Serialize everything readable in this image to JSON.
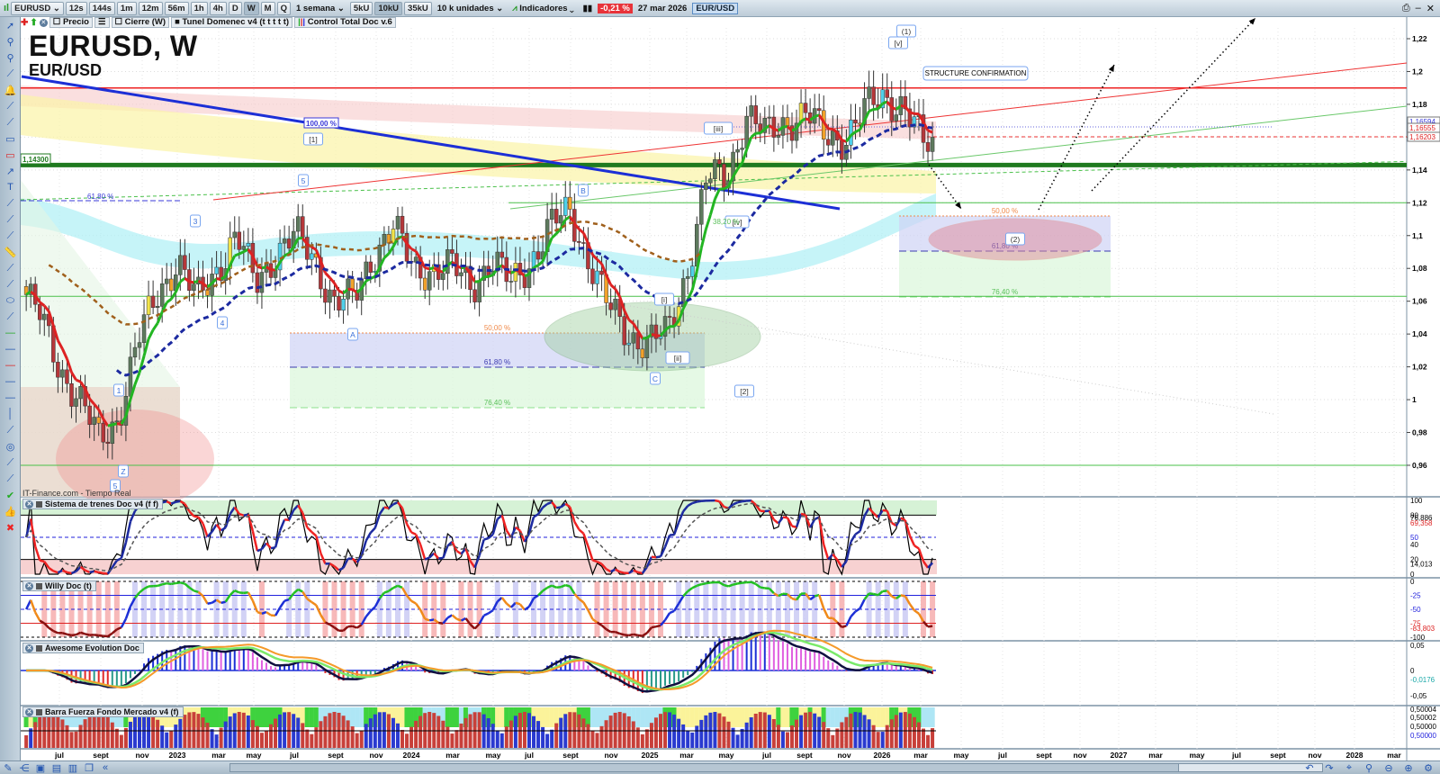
{
  "toolbar": {
    "symbol": "EURUSD",
    "timeframes": [
      "12s",
      "144s",
      "1m",
      "12m",
      "56m",
      "1h",
      "4h",
      "D",
      "W",
      "M",
      "Q"
    ],
    "active_timeframe": "W",
    "period": "1 semana",
    "volume_buttons": [
      "5kU",
      "10kU",
      "35kU"
    ],
    "active_volume": "10kU",
    "units": "10 k unidades",
    "indicators_label": "Indicadores",
    "change_pct": "-0,21 %",
    "date": "27 mar 2026",
    "pair": "EUR/USD"
  },
  "subbar": {
    "items": [
      "Precio",
      "Cierre (W)",
      "Tunel Domenec v4 (t t t t t)",
      "Control Total Doc v.6"
    ]
  },
  "main": {
    "title": "EURUSD, W",
    "subtitle": "EUR/USD",
    "source": "IT-Finance.com - Tiempo Real",
    "level_label": "1,14300",
    "annotation_box": "STRUCTURE CONFIRMATION",
    "fib_left": {
      "p50": "50,00 %",
      "p618": "61,80 %",
      "p764": "76,40 %"
    },
    "fib_right": {
      "p50": "50,00 %",
      "p618": "61,80 %",
      "p764": "76,40 %"
    },
    "fib_100": "100,00 %",
    "fib_6180_left": "61,80 %",
    "fib_382": "38,20 %",
    "waves": [
      "5",
      "Z",
      "1",
      "3",
      "4",
      "5",
      "A",
      "B",
      "C",
      "[i]",
      "[ii]",
      "[iii]",
      "[iv]",
      "[v]",
      "(1)",
      "[1]",
      "[2]",
      "(2)"
    ],
    "price_tags": {
      "blue": "1,16594",
      "red1": "1,16555",
      "red2": "1,16203"
    }
  },
  "price_axis": {
    "ticks": [
      "1,22",
      "1,2",
      "1,18",
      "1,16",
      "1,14",
      "1,12",
      "1,1",
      "1,08",
      "1,06",
      "1,04",
      "1,02",
      "1",
      "0,98",
      "0,96"
    ]
  },
  "panels": [
    {
      "name": "Sistema de trenes Doc v4 (f f)",
      "axis": [
        "100",
        "80",
        "76,886",
        "69,358",
        "50",
        "40",
        "20",
        "14,013",
        "0"
      ]
    },
    {
      "name": "Willy Doc (t)",
      "axis": [
        "0",
        "-25",
        "-50",
        "-75",
        "-83,803",
        "-100"
      ]
    },
    {
      "name": "Awesome Evolution Doc",
      "axis": [
        "0,05",
        "0",
        "-0,0176",
        "-0,05"
      ]
    },
    {
      "name": "Barra Fuerza Fondo Mercado v4 (f)",
      "axis": [
        "0,50004",
        "0,50002",
        "0,50000",
        "0,50000"
      ]
    }
  ],
  "time_axis": {
    "labels": [
      "jul",
      "sept",
      "nov",
      "2023",
      "mar",
      "may",
      "jul",
      "sept",
      "nov",
      "2024",
      "mar",
      "may",
      "jul",
      "sept",
      "nov",
      "2025",
      "mar",
      "may",
      "jul",
      "sept",
      "nov",
      "2026",
      "mar",
      "may",
      "jul",
      "sept",
      "nov",
      "2027",
      "mar",
      "may",
      "jul",
      "sept",
      "nov",
      "2028",
      "mar"
    ]
  },
  "colors": {
    "bull": "#5e7a5e",
    "bear": "#b5373a",
    "accent_red": "#e8333a",
    "green_level": "#1f7a1f",
    "blue_trend": "#1c2fd6"
  },
  "chart_data": {
    "type": "candlestick",
    "interval": "weekly",
    "monthly_close_start": "2022-05",
    "monthly_close": [
      1.07,
      1.05,
      1.02,
      1.0,
      0.975,
      0.99,
      1.035,
      1.065,
      1.085,
      1.06,
      1.08,
      1.1,
      1.07,
      1.09,
      1.1,
      1.085,
      1.06,
      1.06,
      1.09,
      1.105,
      1.08,
      1.08,
      1.08,
      1.07,
      1.085,
      1.07,
      1.085,
      1.105,
      1.115,
      1.085,
      1.055,
      1.04,
      1.035,
      1.04,
      1.08,
      1.135,
      1.135,
      1.175,
      1.16,
      1.17,
      1.175,
      1.16,
      1.16,
      1.175,
      1.185,
      1.18,
      1.155
    ],
    "ylim": [
      0.95,
      1.23
    ],
    "horizontal_levels": [
      1.19,
      1.143,
      1.12,
      1.063,
      0.96
    ]
  }
}
